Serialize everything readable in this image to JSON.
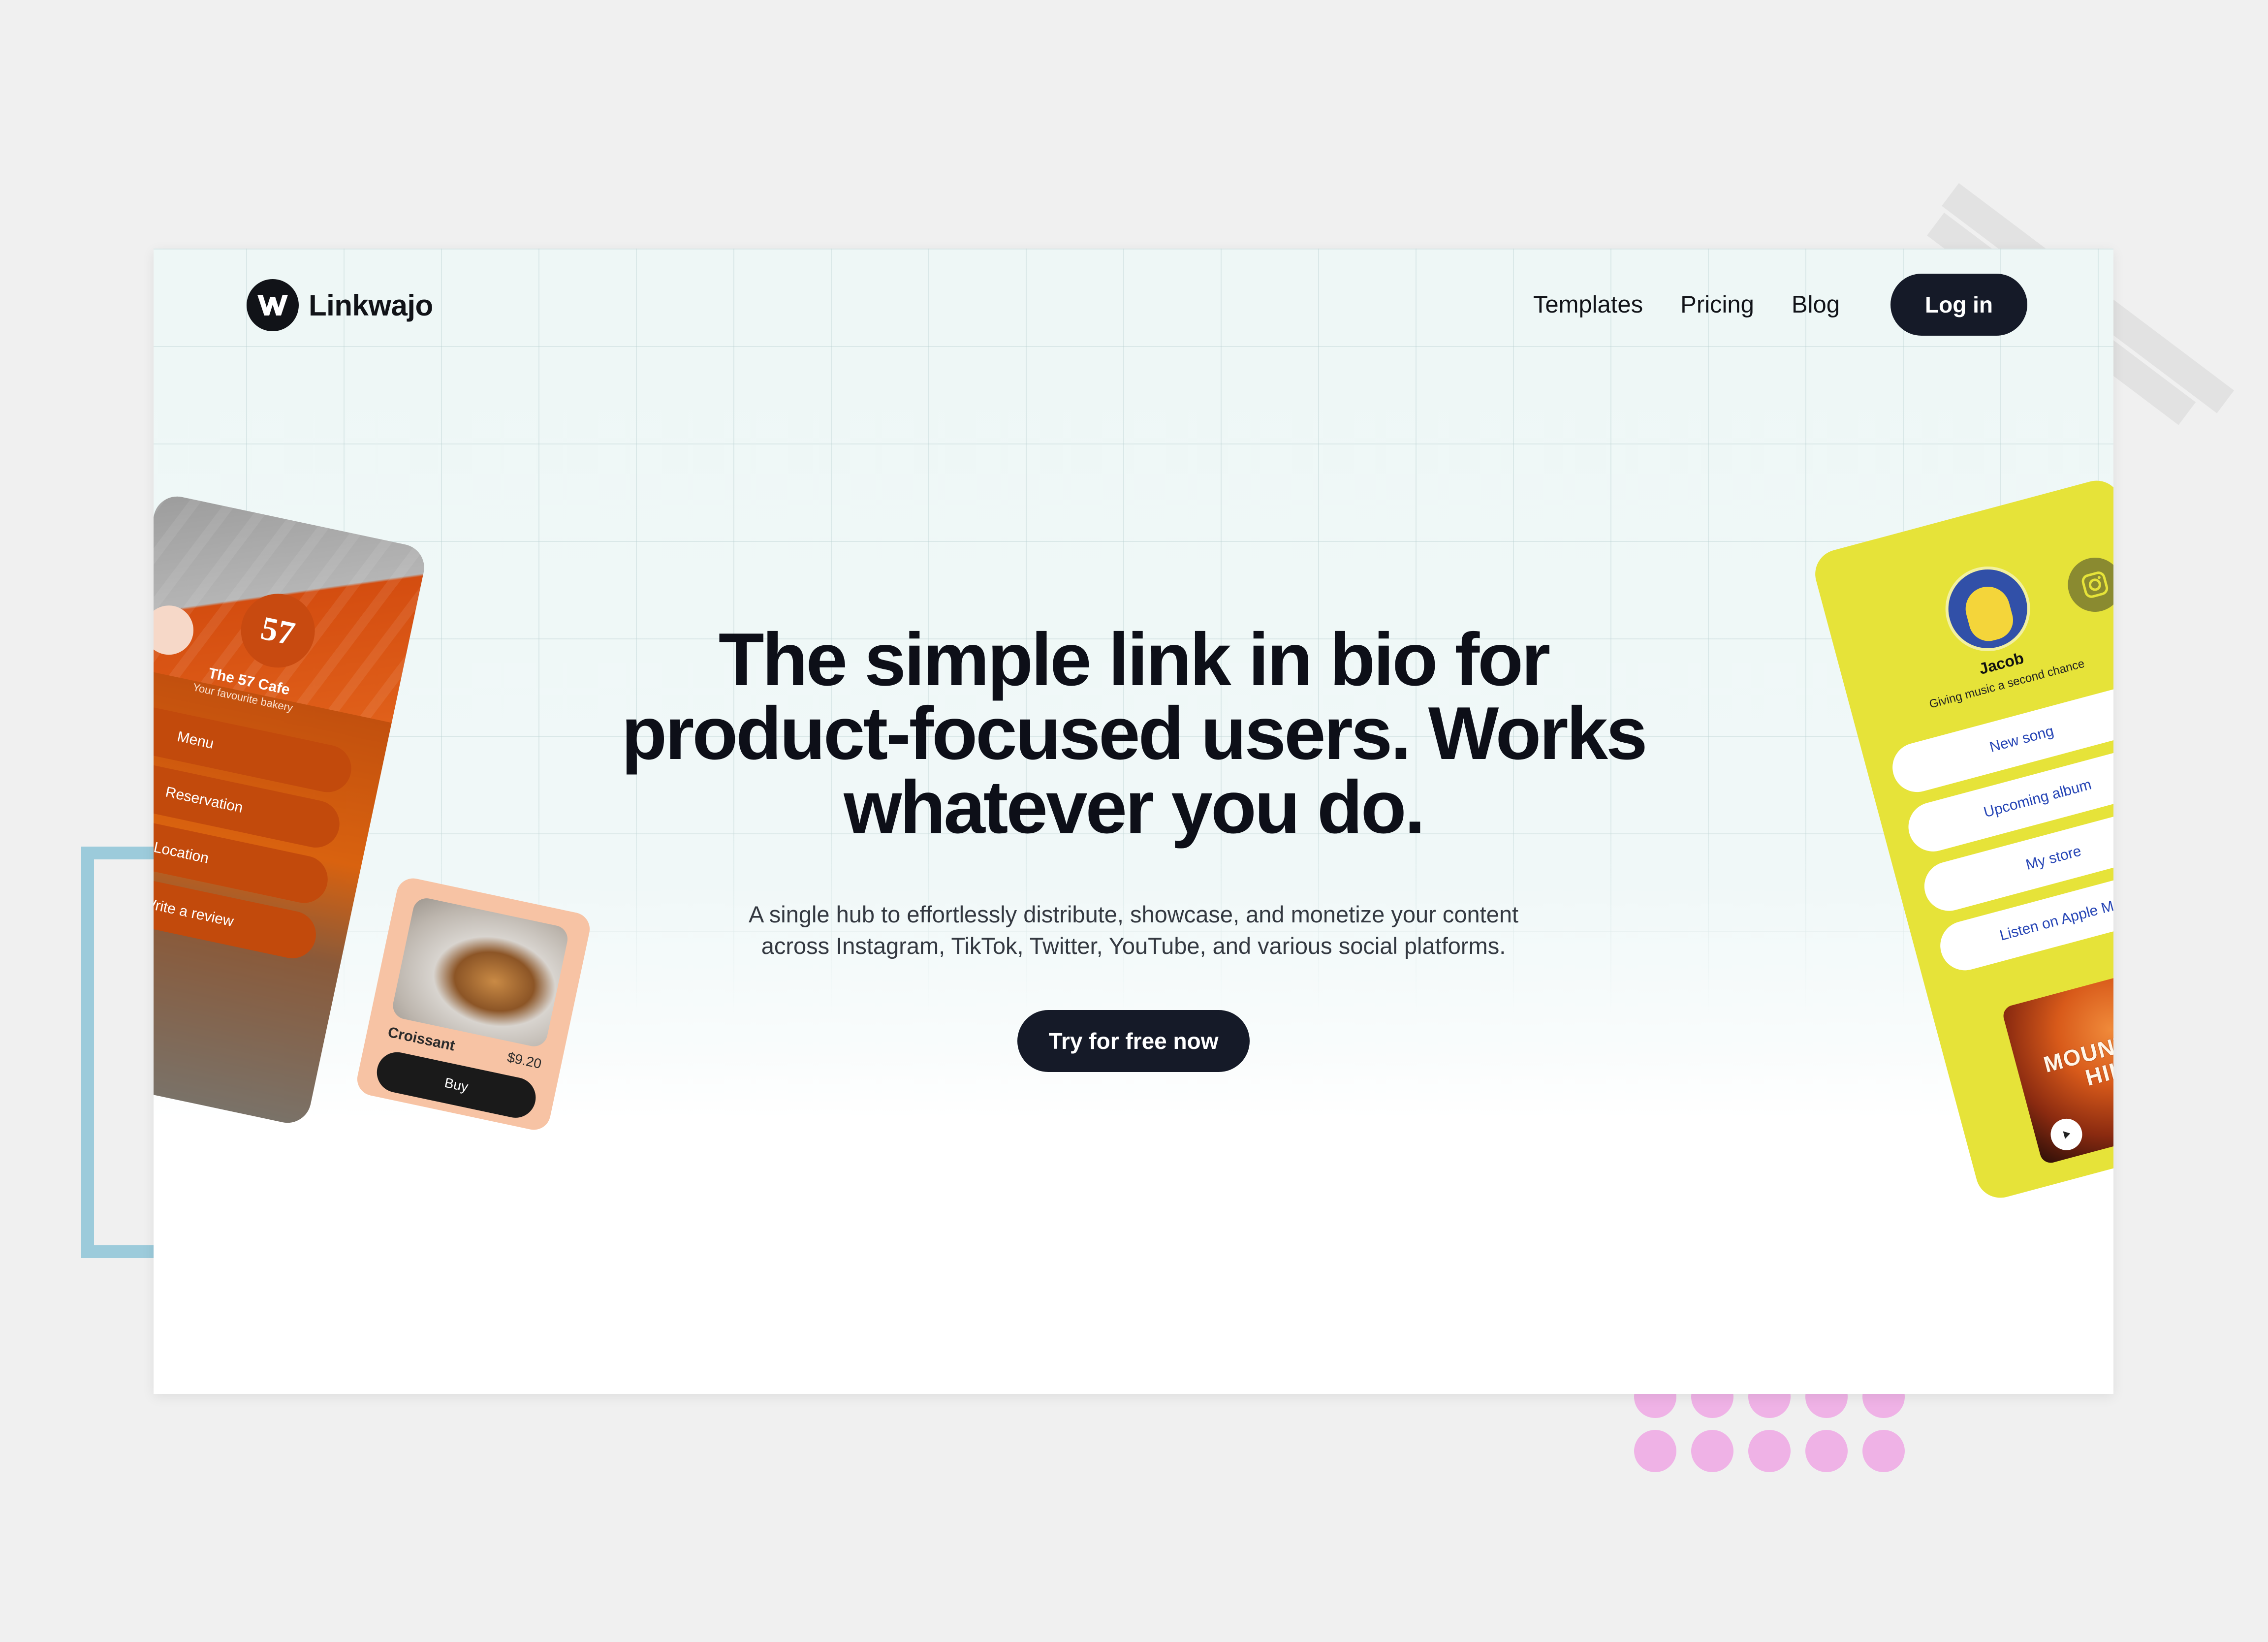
{
  "brand": {
    "name": "Linkwajo",
    "logo_letter": "W"
  },
  "nav": {
    "links": [
      "Templates",
      "Pricing",
      "Blog"
    ],
    "login_label": "Log in"
  },
  "hero": {
    "title_lines": [
      "The simple link in bio for",
      "product-focused users. Works",
      "whatever you do."
    ],
    "subtitle_lines": [
      "A single hub to effortlessly distribute, showcase, and monetize your content",
      "across Instagram, TikTok, Twitter, YouTube, and various social platforms."
    ],
    "cta_label": "Try for free now"
  },
  "cafe_mock": {
    "badge": "57",
    "name": "The 57 Cafe",
    "tagline": "Your favourite bakery",
    "menu_items": [
      "Menu",
      "Reservation",
      "Location",
      "Write a review"
    ],
    "product": {
      "name": "Croissant",
      "price": "$9.20",
      "buy_label": "Buy"
    }
  },
  "music_mock": {
    "name": "Jacob",
    "tagline": "Giving music a second chance",
    "links": [
      "New song",
      "Upcoming album",
      "My store",
      "Listen on Apple Music"
    ],
    "album_title": "MOUNTAIN HILL"
  },
  "colors": {
    "dark": "#151a28",
    "music_yellow": "#e6e339",
    "cafe_orange": "#c24a0c",
    "croissant_card": "#f7c3a4",
    "link_blue": "#2544b5",
    "deco_blue": "#9ccbdb",
    "deco_pink": "#efb2e6"
  },
  "icons": [
    "linkwajo-logo-icon",
    "instagram-icon",
    "play-icon"
  ]
}
